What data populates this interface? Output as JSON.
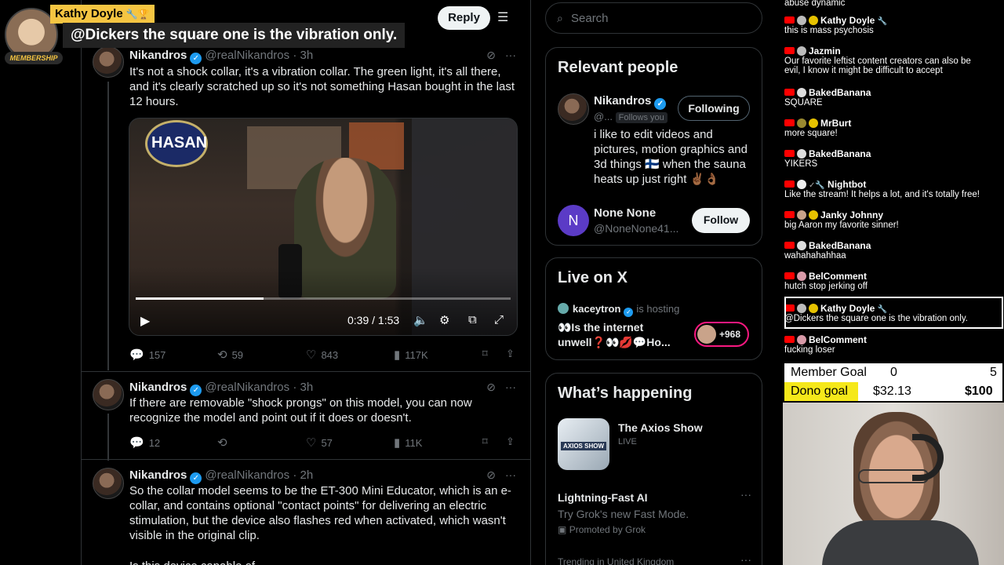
{
  "overlay": {
    "name": "Kathy Doyle",
    "name_icons": "🔧🏆",
    "badge": "MEMBERSHIP",
    "message": "@Dickers the square one is the vibration only."
  },
  "topbar": {
    "reply_label": "Reply",
    "filter_icon": "sliders-icon"
  },
  "tweets": [
    {
      "name": "Nikandros",
      "handle": "@realNikandros",
      "time": "· 3h",
      "text": "It's not a shock collar, it's a vibration collar. The green light, it's all there, and it's clearly scratched up so it's not something Hasan bought in the last 12 hours.",
      "replies": "157",
      "retweets": "59",
      "likes": "843",
      "views": "117K"
    },
    {
      "name": "Nikandros",
      "handle": "@realNikandros",
      "time": "· 3h",
      "text": "If there are removable \"shock prongs\" on this model, you can now recognize the model and point out if it does or doesn't.",
      "replies": "12",
      "retweets": "",
      "likes": "57",
      "views": "11K"
    },
    {
      "name": "Nikandros",
      "handle": "@realNikandros",
      "time": "· 2h",
      "text": "So the collar model seems to be the ET-300 Mini Educator, which is an e-collar, and contains optional \"contact points\" for delivering an electric stimulation, but the device also flashes red when activated, which wasn't visible in the original clip.",
      "text2": "Is this device capable of..."
    }
  ],
  "video": {
    "sign_text": "HASAN",
    "time": "0:39 / 1:53",
    "progress": 0.34
  },
  "sidebar": {
    "search_placeholder": "Search",
    "relevant_title": "Relevant people",
    "people": [
      {
        "name": "Nikandros",
        "handle": "@...",
        "follows_you": "Follows you",
        "button": "Following",
        "bio": "i like to edit videos and pictures, motion graphics and 3d things 🇫🇮 when the sauna heats up just right ✌🏾👌🏾"
      },
      {
        "name": "None None",
        "handle": "@NoneNone41...",
        "avatar_letter": "N",
        "button": "Follow"
      }
    ],
    "live_title": "Live on X",
    "live": {
      "host": "kaceytron",
      "hosting": "is hosting",
      "title": "👀Is the internet unwell❓👀💋💬Ho...",
      "count": "+968"
    },
    "happening_title": "What’s happening",
    "happening": [
      {
        "title": "The Axios Show",
        "status": "LIVE",
        "thumb": "AXIOS SHOW"
      },
      {
        "title": "Lightning-Fast AI",
        "subtitle": "Try Grok's new Fast Mode.",
        "promoted": "Promoted by Grok"
      },
      {
        "title": "Trending in United Kingdom"
      }
    ]
  },
  "chat": [
    {
      "user": "",
      "text": "abuse dynamic"
    },
    {
      "user": "Kathy Doyle",
      "icons": "🔧",
      "text": "this is mass psychosis"
    },
    {
      "user": "Jazmin",
      "text": "Our favorite leftist content creators can also be evil, I know it might be difficult to accept",
      "text2": "evil, I know it might be difficult to accept"
    },
    {
      "user": "BakedBanana",
      "text": "SQUARE"
    },
    {
      "user": "MrBurt",
      "text": "more square!"
    },
    {
      "user": "BakedBanana",
      "text": "YIKERS"
    },
    {
      "user": "Nightbot",
      "icons": "✓🔧",
      "text": "Like the stream! It helps a lot, and it's totally free!"
    },
    {
      "user": "Janky Johnny",
      "text": "big Aaron my favorite sinner!"
    },
    {
      "user": "BakedBanana",
      "text": "wahahahahhaa"
    },
    {
      "user": "BelComment",
      "text": "hutch stop jerking off"
    },
    {
      "user": "Kathy Doyle",
      "icons": "🔧",
      "text": "@Dickers the square one is the vibration only."
    },
    {
      "user": "BelComment",
      "text": "fucking loser"
    }
  ],
  "goals": {
    "member_label": "Member Goal",
    "member_current": "0",
    "member_target": "5",
    "dono_label": "Dono goal",
    "dono_current": "$32.13",
    "dono_target": "$100"
  },
  "colors": {
    "accent": "#1d9bf0",
    "youtube_red": "#ff0000",
    "goal_yellow": "#f5e81a"
  }
}
